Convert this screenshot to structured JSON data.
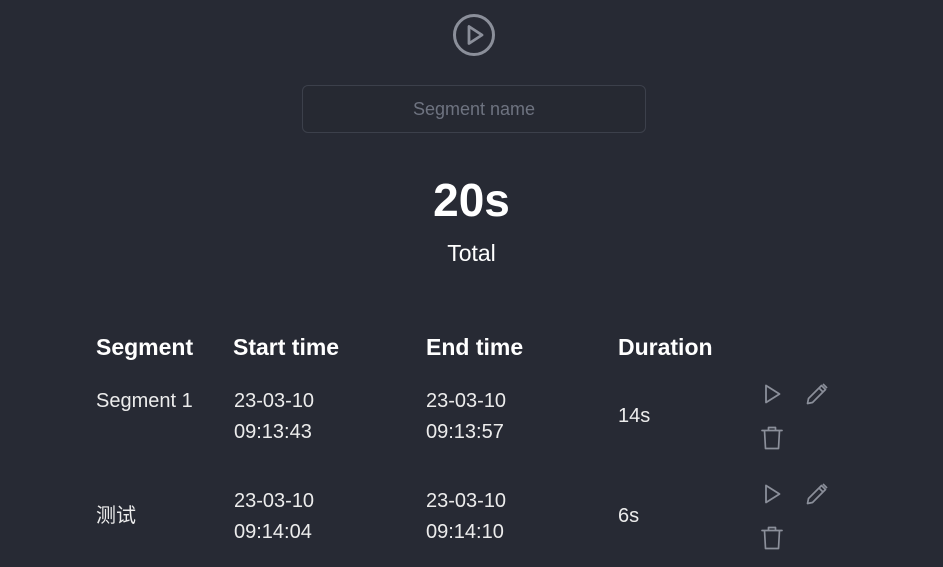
{
  "player": {
    "play_icon": "play-circle-icon"
  },
  "segment_input": {
    "placeholder": "Segment name",
    "value": ""
  },
  "total": {
    "value": "20s",
    "label": "Total"
  },
  "table": {
    "headers": {
      "segment": "Segment",
      "start": "Start time",
      "end": "End time",
      "duration": "Duration"
    },
    "rows": [
      {
        "name": "Segment 1",
        "start_date": "23-03-10",
        "start_time": "09:13:43",
        "end_date": "23-03-10",
        "end_time": "09:13:57",
        "duration": "14s"
      },
      {
        "name": "测试",
        "start_date": "23-03-10",
        "start_time": "09:14:04",
        "end_date": "23-03-10",
        "end_time": "09:14:10",
        "duration": "6s"
      }
    ],
    "row_actions": [
      "play-icon",
      "pencil-icon",
      "trash-icon"
    ]
  },
  "colors": {
    "background": "#272a34",
    "icon": "#8b8f9a",
    "input_border": "#3c404b",
    "placeholder": "#6e7380"
  }
}
